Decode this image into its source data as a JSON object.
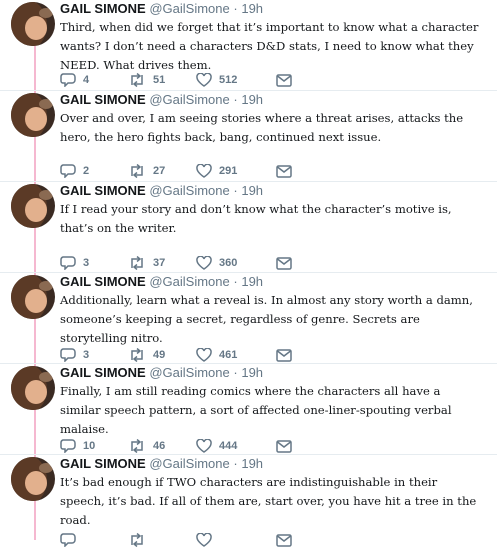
{
  "author": {
    "name": "GAIL SIMONE",
    "handle": "@GailSimone",
    "separator": "·"
  },
  "icons": {
    "reply": "reply-icon",
    "retweet": "retweet-icon",
    "like": "heart-icon",
    "dm": "envelope-icon"
  },
  "colors": {
    "thread_line": "#f5b8d0",
    "icon_gray": "#657786",
    "text": "#14171a"
  },
  "tweets": [
    {
      "time": "19h",
      "text": "Third, when did we forget that it’s important to know what a character wants? I don’t need a characters D&D stats, I need to know what they NEED. What drives them.",
      "replies": "4",
      "retweets": "51",
      "likes": "512"
    },
    {
      "time": "19h",
      "text": "Over and over, I am seeing stories where a threat arises, attacks the hero, the hero fights back, bang, continued next issue.",
      "replies": "2",
      "retweets": "27",
      "likes": "291"
    },
    {
      "time": "19h",
      "text": "If I read your story and don’t know what the character’s motive is, that’s on the writer.",
      "replies": "3",
      "retweets": "37",
      "likes": "360"
    },
    {
      "time": "19h",
      "text": "Additionally, learn what a reveal is. In almost any story worth a damn, someone’s keeping a secret, regardless of genre. Secrets are storytelling nitro.",
      "replies": "3",
      "retweets": "49",
      "likes": "461"
    },
    {
      "time": "19h",
      "text": "Finally, I am still reading comics where the characters all have a similar speech pattern, a sort of affected one-liner-spouting verbal malaise.",
      "replies": "10",
      "retweets": "46",
      "likes": "444"
    },
    {
      "time": "19h",
      "text": "It’s bad enough if TWO characters are indistinguishable in their speech, it’s bad. If all of them are, start over, you have hit a tree in the road.",
      "replies": "",
      "retweets": "",
      "likes": ""
    }
  ]
}
